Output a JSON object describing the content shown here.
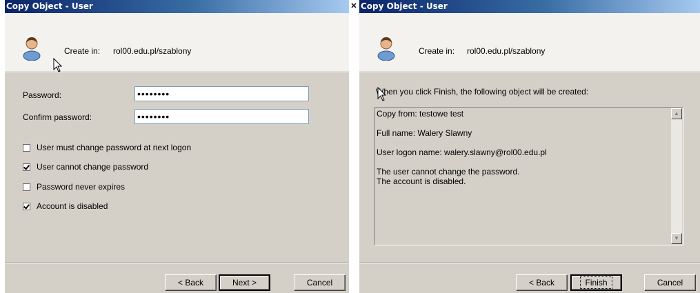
{
  "left_dialog": {
    "title": "Copy Object - User",
    "create_in_label": "Create in:",
    "create_in_path": "rol00.edu.pl/szablony",
    "password_label": "Password:",
    "password_value": "••••••••",
    "confirm_label": "Confirm password:",
    "confirm_value": "••••••••",
    "options": [
      {
        "label": "User must change password at next logon",
        "checked": false
      },
      {
        "label": "User cannot change password",
        "checked": true
      },
      {
        "label": "Password never expires",
        "checked": false
      },
      {
        "label": "Account is disabled",
        "checked": true
      }
    ],
    "buttons": {
      "back": "< Back",
      "next": "Next >",
      "cancel": "Cancel"
    }
  },
  "right_dialog": {
    "title": "Copy Object - User",
    "create_in_label": "Create in:",
    "create_in_path": "rol00.edu.pl/szablony",
    "intro": "When you click Finish, the following object will be created:",
    "summary": {
      "copy_from": "Copy from: testowe test",
      "full_name": "Full name: Walery Slawny",
      "logon": "User logon name: walery.slawny@rol00.edu.pl",
      "note1": "The user cannot change the password.",
      "note2": "The account is disabled."
    },
    "buttons": {
      "back": "< Back",
      "finish": "Finish",
      "cancel": "Cancel"
    }
  },
  "icons": {
    "user": "user-icon",
    "cursor": "mouse-cursor-icon",
    "close": "close-icon",
    "scroll_up": "scroll-up-arrow-icon",
    "scroll_down": "scroll-down-arrow-icon"
  },
  "colors": {
    "titlebar_start": "#0a246a",
    "titlebar_end": "#a6caf0",
    "dialog_bg": "#d4d0c8",
    "header_bg": "#f3f2ee"
  }
}
